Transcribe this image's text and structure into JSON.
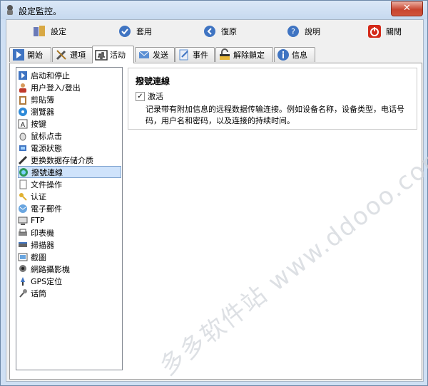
{
  "window": {
    "title": "設定監控。",
    "close_glyph": "✕"
  },
  "toolbar": {
    "buttons": [
      {
        "label": "設定",
        "icon": "settings-icon"
      },
      {
        "label": "套用",
        "icon": "apply-icon"
      },
      {
        "label": "復原",
        "icon": "undo-icon"
      },
      {
        "label": "說明",
        "icon": "help-icon"
      },
      {
        "label": "關閉",
        "icon": "power-icon"
      }
    ]
  },
  "tabs": [
    {
      "label": "開始",
      "icon": "play-icon"
    },
    {
      "label": "選項",
      "icon": "tools-icon"
    },
    {
      "label": "活动",
      "icon": "activity-icon",
      "active": true
    },
    {
      "label": "发送",
      "icon": "send-icon"
    },
    {
      "label": "事件",
      "icon": "event-icon"
    },
    {
      "label": "解除鎖定",
      "icon": "unlock-icon"
    },
    {
      "label": "信息",
      "icon": "info-icon"
    }
  ],
  "activity_list": [
    {
      "label": "启动和停止",
      "icon": "start-stop-icon"
    },
    {
      "label": "用户登入/登出",
      "icon": "user-icon"
    },
    {
      "label": "剪貼簿",
      "icon": "clipboard-icon"
    },
    {
      "label": "瀏覽器",
      "icon": "browser-icon"
    },
    {
      "label": "按键",
      "icon": "key-icon"
    },
    {
      "label": "鼠标点击",
      "icon": "mouse-icon"
    },
    {
      "label": "電源狀態",
      "icon": "power-state-icon"
    },
    {
      "label": "更换数据存储介质",
      "icon": "storage-icon"
    },
    {
      "label": "撥號連線",
      "icon": "dialup-icon",
      "selected": true
    },
    {
      "label": "文件操作",
      "icon": "file-icon"
    },
    {
      "label": "认证",
      "icon": "auth-key-icon"
    },
    {
      "label": "電子郵件",
      "icon": "email-icon"
    },
    {
      "label": "FTP",
      "icon": "ftp-icon"
    },
    {
      "label": "印表機",
      "icon": "printer-icon"
    },
    {
      "label": "掃描器",
      "icon": "scanner-icon"
    },
    {
      "label": "截圖",
      "icon": "screenshot-icon"
    },
    {
      "label": "網路攝影機",
      "icon": "webcam-icon"
    },
    {
      "label": "GPS定位",
      "icon": "gps-icon"
    },
    {
      "label": "话筒",
      "icon": "microphone-icon"
    }
  ],
  "detail": {
    "title": "撥號連線",
    "checkbox_label": "激活",
    "checkbox_checked": true,
    "checkmark": "✓",
    "description": "记录带有附加信息的远程数据传输连接。例如设备名称，设备类型，电话号码，用户名和密码，以及连接的持续时间。"
  },
  "watermark": "多多软件站 www.ddooo.com",
  "colors": {
    "selection": "#cfe3fb",
    "titlebar": "#c6d9ef",
    "close": "#c8452f"
  }
}
